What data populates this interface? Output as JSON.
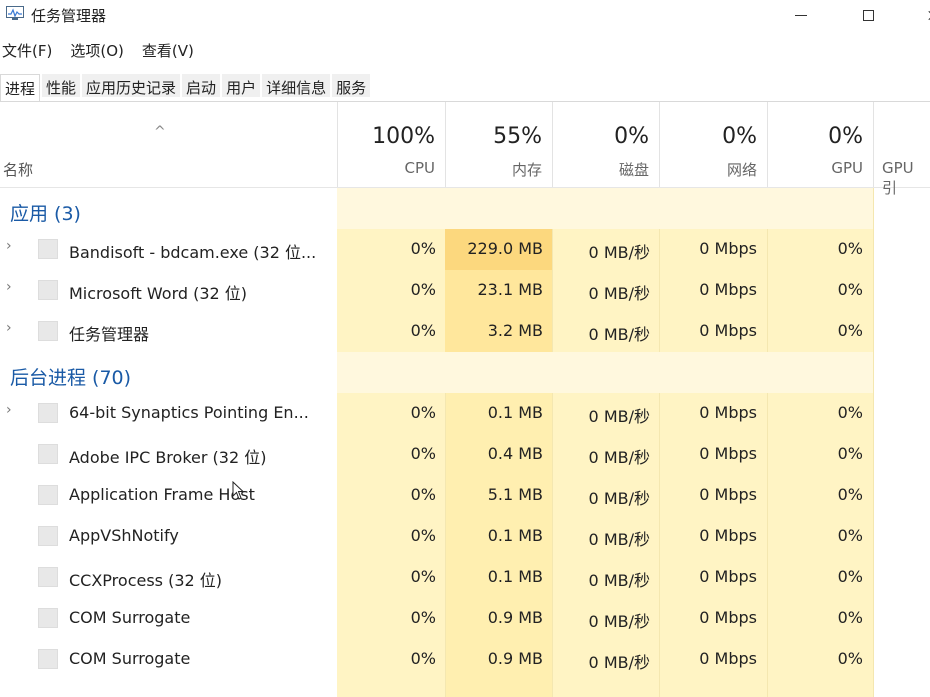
{
  "window": {
    "title": "任务管理器"
  },
  "menu": [
    "文件(F)",
    "选项(O)",
    "查看(V)"
  ],
  "tabs": [
    {
      "label": "进程",
      "active": true
    },
    {
      "label": "性能",
      "active": false
    },
    {
      "label": "应用历史记录",
      "active": false
    },
    {
      "label": "启动",
      "active": false
    },
    {
      "label": "用户",
      "active": false
    },
    {
      "label": "详细信息",
      "active": false
    },
    {
      "label": "服务",
      "active": false
    }
  ],
  "header": {
    "name_label": "名称",
    "sort_indicator": "^",
    "columns": [
      {
        "key": "cpu",
        "pct": "100%",
        "label": "CPU"
      },
      {
        "key": "mem",
        "pct": "55%",
        "label": "内存"
      },
      {
        "key": "disk",
        "pct": "0%",
        "label": "磁盘"
      },
      {
        "key": "net",
        "pct": "0%",
        "label": "网络"
      },
      {
        "key": "gpu",
        "pct": "0%",
        "label": "GPU"
      },
      {
        "key": "gpuengine",
        "pct": "",
        "label": "GPU 引"
      }
    ]
  },
  "groups": [
    {
      "title": "应用 (3)",
      "rows": [
        {
          "name": "Bandisoft - bdcam.exe (32 位...",
          "expandable": true,
          "cpu": "0%",
          "mem": "229.0 MB",
          "disk": "0 MB/秒",
          "net": "0 Mbps",
          "gpu": "0%"
        },
        {
          "name": "Microsoft Word (32 位)",
          "expandable": true,
          "cpu": "0%",
          "mem": "23.1 MB",
          "disk": "0 MB/秒",
          "net": "0 Mbps",
          "gpu": "0%"
        },
        {
          "name": "任务管理器",
          "expandable": true,
          "cpu": "0%",
          "mem": "3.2 MB",
          "disk": "0 MB/秒",
          "net": "0 Mbps",
          "gpu": "0%"
        }
      ]
    },
    {
      "title": "后台进程 (70)",
      "rows": [
        {
          "name": "64-bit Synaptics Pointing En...",
          "expandable": true,
          "cpu": "0%",
          "mem": "0.1 MB",
          "disk": "0 MB/秒",
          "net": "0 Mbps",
          "gpu": "0%"
        },
        {
          "name": "Adobe IPC Broker (32 位)",
          "expandable": false,
          "cpu": "0%",
          "mem": "0.4 MB",
          "disk": "0 MB/秒",
          "net": "0 Mbps",
          "gpu": "0%"
        },
        {
          "name": "Application Frame Host",
          "expandable": false,
          "cpu": "0%",
          "mem": "5.1 MB",
          "disk": "0 MB/秒",
          "net": "0 Mbps",
          "gpu": "0%"
        },
        {
          "name": "AppVShNotify",
          "expandable": false,
          "cpu": "0%",
          "mem": "0.1 MB",
          "disk": "0 MB/秒",
          "net": "0 Mbps",
          "gpu": "0%"
        },
        {
          "name": "CCXProcess (32 位)",
          "expandable": false,
          "cpu": "0%",
          "mem": "0.1 MB",
          "disk": "0 MB/秒",
          "net": "0 Mbps",
          "gpu": "0%"
        },
        {
          "name": "COM Surrogate",
          "expandable": false,
          "cpu": "0%",
          "mem": "0.9 MB",
          "disk": "0 MB/秒",
          "net": "0 Mbps",
          "gpu": "0%"
        },
        {
          "name": "COM Surrogate",
          "expandable": false,
          "cpu": "0%",
          "mem": "0.9 MB",
          "disk": "0 MB/秒",
          "net": "0 Mbps",
          "gpu": "0%"
        }
      ]
    }
  ],
  "colors": {
    "group_title": "#1a5aa6",
    "heat_high": "#fcd87e",
    "heat_mid": "#ffe79c",
    "heat_low": "#fff4c4"
  },
  "icons": {
    "app": "task-manager-icon",
    "process": "process-icon",
    "expander": "chevron-right-icon"
  }
}
